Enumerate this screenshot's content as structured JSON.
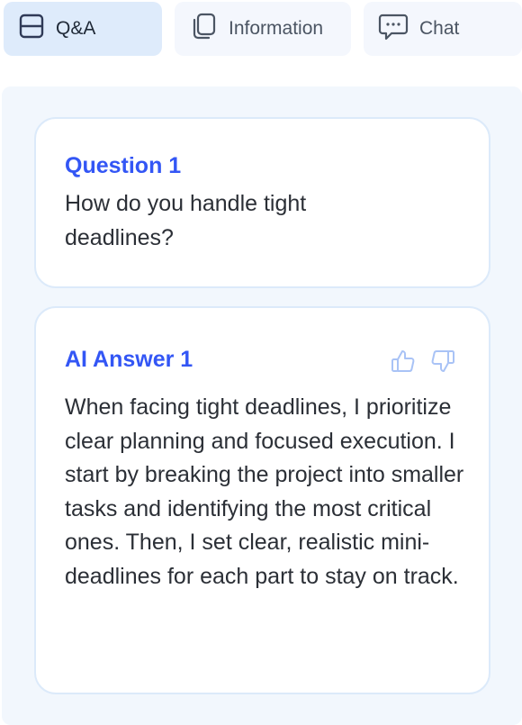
{
  "tabs": {
    "qa": "Q&A",
    "information": "Information",
    "chat": "Chat"
  },
  "question": {
    "title": "Question 1",
    "text": "How do you handle tight deadlines?"
  },
  "answer": {
    "title": "AI Answer 1",
    "text": "When facing tight deadlines, I prioritize clear planning and focused execution. I start by breaking the project into smaller tasks and identifying the most critical ones. Then, I set clear, realistic mini-deadlines for each part to stay on track."
  },
  "colors": {
    "accent": "#3356f5",
    "active_tab": "#deebfb",
    "panel_bg": "#f2f7fd",
    "card_border": "#dceafa"
  },
  "icons": {
    "qa": "panel-layout-icon",
    "information": "copy-documents-icon",
    "chat": "chat-bubble-icon",
    "like": "thumbs-up-icon",
    "dislike": "thumbs-down-icon"
  }
}
